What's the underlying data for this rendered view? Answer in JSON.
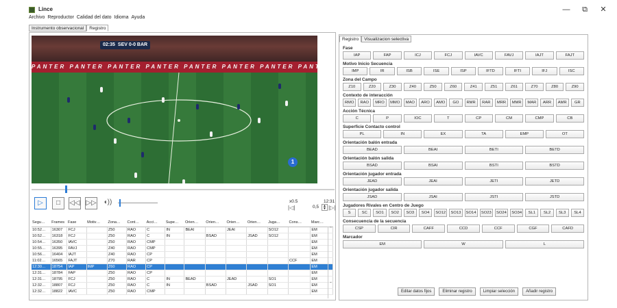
{
  "window": {
    "title": "Lince",
    "minimize": "—",
    "maximize": "⧉",
    "close": "✕"
  },
  "menu": [
    "Archivo",
    "Reproductor",
    "Calidad del dato",
    "Idioma",
    "Ayuda"
  ],
  "main_tabs": [
    "Instrumento observacional",
    "Registro"
  ],
  "video": {
    "scoreboard_time": "02:35",
    "scoreboard_score": "SEV 0-0 BAR",
    "ad_text": "PANTER   PANTER   PANTER   PANTER   PANTER   PANTER   PANTER   PANTER",
    "marker": "1",
    "progress": 0.11
  },
  "controls": {
    "speed": "x0.5",
    "time": "12:31",
    "rate_value": "0,5",
    "icons": [
      "play-icon",
      "stop-icon",
      "rewind-icon",
      "fast-forward-icon",
      "volume-icon"
    ]
  },
  "table": {
    "headers": [
      "Segu…",
      "Frames",
      "Fase",
      "Motiv…",
      "Zona…",
      "Cont…",
      "Acci…",
      "Supe…",
      "Orien…",
      "Orien…",
      "Orien…",
      "Orien…",
      "Juga…",
      "Cons…",
      "Marc…"
    ],
    "rows": [
      [
        "10:52…",
        "16307",
        "FCJ",
        "",
        "Z50",
        "RAO",
        "C",
        "IN",
        "BEAI",
        "",
        "JEAI",
        "",
        "SO12",
        "",
        "EM"
      ],
      [
        "10:52…",
        "16318",
        "FCJ",
        "",
        "Z50",
        "RAO",
        "C",
        "IN",
        "",
        "BSAD",
        "",
        "JSAD",
        "SO12",
        "",
        "EM"
      ],
      [
        "10:54…",
        "16350",
        "IAVC",
        "",
        "Z50",
        "RAO",
        "CMP",
        "",
        "",
        "",
        "",
        "",
        "",
        "",
        "EM"
      ],
      [
        "10:55…",
        "16395",
        "FAVJ",
        "",
        "Z40",
        "RAO",
        "CMP",
        "",
        "",
        "",
        "",
        "",
        "",
        "",
        "EM"
      ],
      [
        "10:56…",
        "16404",
        "IAJT",
        "",
        "Z40",
        "RAO",
        "CP",
        "",
        "",
        "",
        "",
        "",
        "",
        "",
        "EM"
      ],
      [
        "11:02…",
        "16565",
        "FAJT",
        "",
        "Z70",
        "RAR",
        "CP",
        "",
        "",
        "",
        "",
        "",
        "",
        "CCF",
        "EM"
      ],
      [
        "12:30…",
        "18754",
        "IAP",
        "IMP",
        "Z60",
        "RAO",
        "CP",
        "",
        "",
        "",
        "",
        "",
        "",
        "",
        "EM"
      ],
      [
        "12:31…",
        "18784",
        "FAP",
        "",
        "Z50",
        "RAO",
        "CP",
        "",
        "",
        "",
        "",
        "",
        "",
        "",
        "EM"
      ],
      [
        "12:31…",
        "18795",
        "FCJ",
        "",
        "Z50",
        "RAO",
        "C",
        "IN",
        "BEAD",
        "",
        "JEAD",
        "",
        "SO1",
        "",
        "EM"
      ],
      [
        "12:32…",
        "18807",
        "FCJ",
        "",
        "Z50",
        "RAO",
        "C",
        "IN",
        "",
        "BSAD",
        "",
        "JSAD",
        "SO1",
        "",
        "EM"
      ],
      [
        "12:32…",
        "18822",
        "IAVC",
        "",
        "Z50",
        "RAO",
        "CMP",
        "",
        "",
        "",
        "",
        "",
        "",
        "",
        "EM"
      ]
    ],
    "selected_row": 6
  },
  "right_tabs": [
    "Registro",
    "Visualizacion selectiva"
  ],
  "criteria": [
    {
      "title": "Fase",
      "buttons": [
        "IAP",
        "FAP",
        "ICJ",
        "FCJ",
        "IAVC",
        "FAVJ",
        "IAJT",
        "FAJT"
      ]
    },
    {
      "title": "Motivo Inicio Secuencia",
      "buttons": [
        "IMP",
        "IR",
        "ISB",
        "ISE",
        "ISP",
        "IFTD",
        "IFTI",
        "IFJ",
        "ISC"
      ]
    },
    {
      "title": "Zona del Campo",
      "buttons": [
        "Z10",
        "Z20",
        "Z30",
        "Z40",
        "Z50",
        "Z60",
        "Z41",
        "Z51",
        "Z61",
        "Z70",
        "Z80",
        "Z90"
      ]
    },
    {
      "title": "Contexto de interacción",
      "buttons": [
        "RMO",
        "RAO",
        "MRO",
        "MMO",
        "MAO",
        "ARO",
        "AMO",
        "GO",
        "RMR",
        "RAR",
        "MRR",
        "MMR",
        "MAR",
        "ARR",
        "AMR",
        "GR"
      ]
    },
    {
      "title": "Acción Técnica",
      "buttons": [
        "C",
        "P",
        "IOC",
        "T",
        "CP",
        "CM",
        "CMP",
        "CB"
      ]
    },
    {
      "title": "Superficie Contacto control",
      "buttons": [
        "PL",
        "IN",
        "EX",
        "TA",
        "EMP",
        "OT"
      ]
    },
    {
      "title": "Orientación balón entrada",
      "buttons": [
        "BEAD",
        "BEAI",
        "BETI",
        "BETD"
      ]
    },
    {
      "title": "Orientación balón salida",
      "buttons": [
        "BSAD",
        "BSAI",
        "BSTI",
        "BSTD"
      ]
    },
    {
      "title": "Orientación jugador entrada",
      "buttons": [
        "JEAD",
        "JEAI",
        "JETI",
        "JETD"
      ]
    },
    {
      "title": "Orientación jugador salida",
      "buttons": [
        "JSAD",
        "JSAI",
        "JSTI",
        "JSTD"
      ]
    },
    {
      "title": "Jugadores Rivales en Centro de Juego",
      "buttons": [
        "S",
        "SC",
        "SO1",
        "SO2",
        "SO3",
        "SO4",
        "SO12",
        "SO13",
        "SO14",
        "SO23",
        "SO24",
        "SO34",
        "SL1",
        "SL2",
        "SL3",
        "SL4"
      ]
    },
    {
      "title": "Consecuencia de la secuencia",
      "buttons": [
        "CSP",
        "CIR",
        "CAFF",
        "CCD",
        "CCF",
        "CGF",
        "CAFD"
      ]
    },
    {
      "title": "Marcador",
      "buttons": [
        "EM",
        "W",
        "L"
      ]
    }
  ],
  "actions": [
    "Editar datos fijos",
    "Eliminar registro",
    "Limpiar selección",
    "Añadir registro"
  ]
}
